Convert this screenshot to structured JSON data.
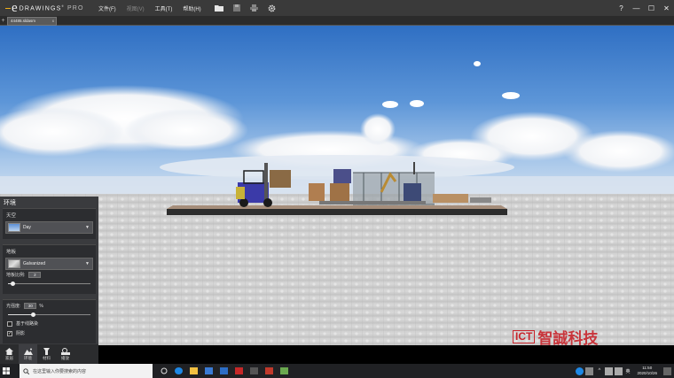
{
  "app": {
    "logo_mark": "e",
    "logo_name": "DRAWINGS",
    "logo_suffix": "PRO"
  },
  "menu": [
    {
      "label": "文件(F)",
      "enabled": true
    },
    {
      "label": "视图(V)",
      "enabled": false
    },
    {
      "label": "工具(T)",
      "enabled": true
    },
    {
      "label": "帮助(H)",
      "enabled": true
    }
  ],
  "toolbar_icons": [
    "folder-open-icon",
    "save-icon",
    "print-icon",
    "settings-gear-icon"
  ],
  "window_controls": {
    "help": "?",
    "minimize": "—",
    "maximize": "☐",
    "close": "✕"
  },
  "document_tab": {
    "plus": "+",
    "name": "44485.sldasm",
    "close": "x"
  },
  "panel": {
    "title": "环境",
    "sky": {
      "label": "天空",
      "value": "Day"
    },
    "floor": {
      "label": "地板",
      "value": "Galvanized",
      "scale_label": "地板比例:",
      "scale_value": "2",
      "scale_level": 0.05
    },
    "light": {
      "label": "光强度:",
      "value": "30",
      "unit": "%",
      "level": 0.3
    },
    "checks": [
      {
        "label": "基于线路染",
        "checked": false
      },
      {
        "label": "阴影",
        "checked": true
      }
    ]
  },
  "panel_tabs": [
    {
      "label": "家居",
      "icon": "home-icon",
      "active": false
    },
    {
      "label": "环境",
      "icon": "landscape-icon",
      "active": true
    },
    {
      "label": "材料",
      "icon": "paint-bucket-icon",
      "active": false
    },
    {
      "label": "播放",
      "icon": "camera-settings-icon",
      "active": false
    }
  ],
  "watermark": {
    "badge": "ICT",
    "text": "智誠科技"
  },
  "taskbar": {
    "search_placeholder": "在这里输入你要搜索的内容",
    "time": "11:50",
    "date": "2020/10/26",
    "tray_text": "英"
  }
}
